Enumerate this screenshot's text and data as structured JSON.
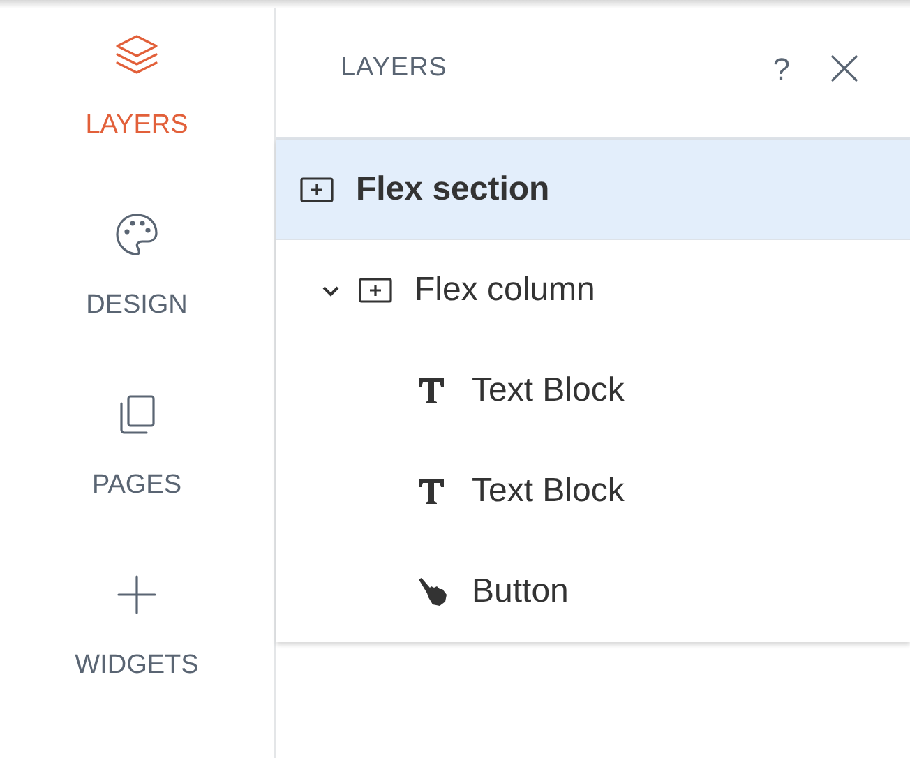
{
  "nav": [
    {
      "label": "LAYERS",
      "kind": "layers",
      "selected": true
    },
    {
      "label": "DESIGN",
      "kind": "design",
      "selected": false
    },
    {
      "label": "PAGES",
      "kind": "pages",
      "selected": false
    },
    {
      "label": "WIDGETS",
      "kind": "widgets",
      "selected": false
    }
  ],
  "panel": {
    "title": "LAYERS",
    "help": "?"
  },
  "layers": [
    {
      "label": "Flex section",
      "kind": "container",
      "selected": true,
      "children": [
        {
          "label": "Flex column",
          "kind": "container",
          "selected": false,
          "expanded": true,
          "children": [
            {
              "label": "Text Block",
              "kind": "text",
              "selected": false
            },
            {
              "label": "Text Block",
              "kind": "text",
              "selected": false
            },
            {
              "label": "Button",
              "kind": "button",
              "selected": false
            }
          ]
        }
      ]
    }
  ]
}
